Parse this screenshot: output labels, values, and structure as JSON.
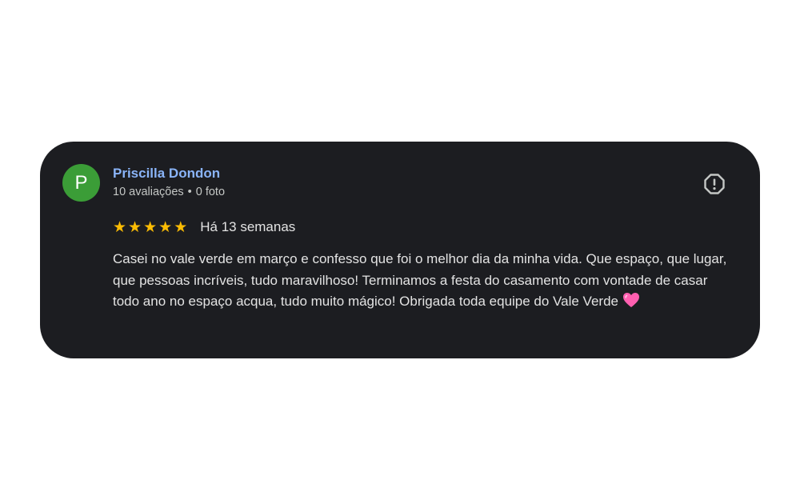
{
  "review": {
    "avatar_letter": "P",
    "reviewer_name": "Priscilla Dondon",
    "reviews_count": "10 avaliações",
    "separator": "•",
    "photos_count": "0 foto",
    "rating": 5,
    "rating_max": 5,
    "date": "Há 13 semanas",
    "text": "Casei no vale verde em março e confesso que foi o melhor dia da minha vida. Que espaço, que lugar, que pessoas incríveis, tudo maravilhoso! Terminamos a festa do casamento com vontade de casar todo ano no espaço acqua, tudo muito mágico! Obrigada toda equipe do Vale Verde",
    "emoji": "pink-heart-icon",
    "report_icon": "report-icon"
  },
  "colors": {
    "card_background": "#1c1d21",
    "avatar_background": "#3b9d37",
    "name": "#8ab4f8",
    "star": "#fbbc04"
  }
}
